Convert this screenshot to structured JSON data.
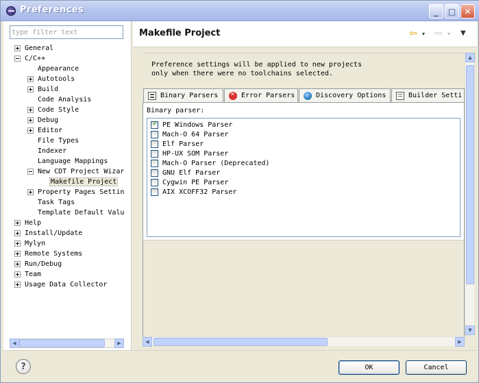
{
  "window": {
    "title": "Preferences",
    "controls": {
      "minimize": "_",
      "maximize": "□",
      "close": "✕"
    }
  },
  "filter": {
    "placeholder": "type filter text",
    "value": ""
  },
  "tree": [
    {
      "label": "General",
      "toggle": "plus",
      "level": 0
    },
    {
      "label": "C/C++",
      "toggle": "minus",
      "level": 0
    },
    {
      "label": "Appearance",
      "toggle": "none",
      "level": 1
    },
    {
      "label": "Autotools",
      "toggle": "plus",
      "level": 1
    },
    {
      "label": "Build",
      "toggle": "plus",
      "level": 1
    },
    {
      "label": "Code Analysis",
      "toggle": "none",
      "level": 1
    },
    {
      "label": "Code Style",
      "toggle": "plus",
      "level": 1
    },
    {
      "label": "Debug",
      "toggle": "plus",
      "level": 1
    },
    {
      "label": "Editor",
      "toggle": "plus",
      "level": 1
    },
    {
      "label": "File Types",
      "toggle": "none",
      "level": 1
    },
    {
      "label": "Indexer",
      "toggle": "none",
      "level": 1
    },
    {
      "label": "Language Mappings",
      "toggle": "none",
      "level": 1
    },
    {
      "label": "New CDT Project Wizar",
      "toggle": "minus",
      "level": 1
    },
    {
      "label": "Makefile Project",
      "toggle": "none",
      "level": 2,
      "selected": true
    },
    {
      "label": "Property Pages Settin",
      "toggle": "plus",
      "level": 1
    },
    {
      "label": "Task Tags",
      "toggle": "none",
      "level": 1
    },
    {
      "label": "Template Default Valu",
      "toggle": "none",
      "level": 1
    },
    {
      "label": "Help",
      "toggle": "plus",
      "level": 0
    },
    {
      "label": "Install/Update",
      "toggle": "plus",
      "level": 0
    },
    {
      "label": "Mylyn",
      "toggle": "plus",
      "level": 0
    },
    {
      "label": "Remote Systems",
      "toggle": "plus",
      "level": 0
    },
    {
      "label": "Run/Debug",
      "toggle": "plus",
      "level": 0
    },
    {
      "label": "Team",
      "toggle": "plus",
      "level": 0
    },
    {
      "label": "Usage Data Collector",
      "toggle": "plus",
      "level": 0
    }
  ],
  "page": {
    "title": "Makefile Project",
    "nav": {
      "back": "⇦",
      "forward": "⇨",
      "dropdown": "▾",
      "menu": "▼"
    },
    "info_line_1": "Preference settings will be applied to new projects",
    "info_line_2": "only when there were no toolchains selected."
  },
  "tabs": [
    {
      "label": "Binary Parsers",
      "icon": "binary-parser-icon",
      "active": true
    },
    {
      "label": "Error Parsers",
      "icon": "error-icon",
      "active": false
    },
    {
      "label": "Discovery Options",
      "icon": "discovery-icon",
      "active": false
    },
    {
      "label": "Builder Setti",
      "icon": "builder-settings-icon",
      "active": false
    }
  ],
  "binary_parser": {
    "label": "Binary parser:",
    "parsers": [
      {
        "label": "PE Windows Parser",
        "checked": true
      },
      {
        "label": "Mach-O 64 Parser",
        "checked": false
      },
      {
        "label": "Elf Parser",
        "checked": false
      },
      {
        "label": "HP-UX SOM Parser",
        "checked": false
      },
      {
        "label": "Mach-O Parser (Deprecated)",
        "checked": false
      },
      {
        "label": "GNU Elf Parser",
        "checked": false
      },
      {
        "label": "Cygwin PE Parser",
        "checked": false
      },
      {
        "label": "AIX XCOFF32 Parser",
        "checked": false
      }
    ]
  },
  "scroll": {
    "up": "▲",
    "down": "▼",
    "left": "◀",
    "right": "▶"
  },
  "buttons": {
    "help": "?",
    "ok": "OK",
    "cancel": "Cancel"
  }
}
